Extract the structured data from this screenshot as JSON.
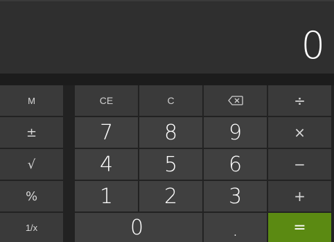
{
  "display": {
    "value": "0"
  },
  "memory_column": {
    "memory": "M",
    "plus_minus": "±",
    "sqrt": "√",
    "percent": "%",
    "reciprocal": "1/x"
  },
  "keys": {
    "ce": "CE",
    "c": "C",
    "backspace_icon": "backspace-icon",
    "divide": "÷",
    "multiply": "×",
    "subtract": "−",
    "add": "+",
    "equals": "=",
    "dot": ".",
    "digits": {
      "d0": "0",
      "d1": "1",
      "d2": "2",
      "d3": "3",
      "d4": "4",
      "d5": "5",
      "d6": "6",
      "d7": "7",
      "d8": "8",
      "d9": "9"
    }
  },
  "colors": {
    "equals_accent": "#5b8a12",
    "display_bg": "#2f2f2f",
    "key_bg": "#3c3c3c"
  }
}
